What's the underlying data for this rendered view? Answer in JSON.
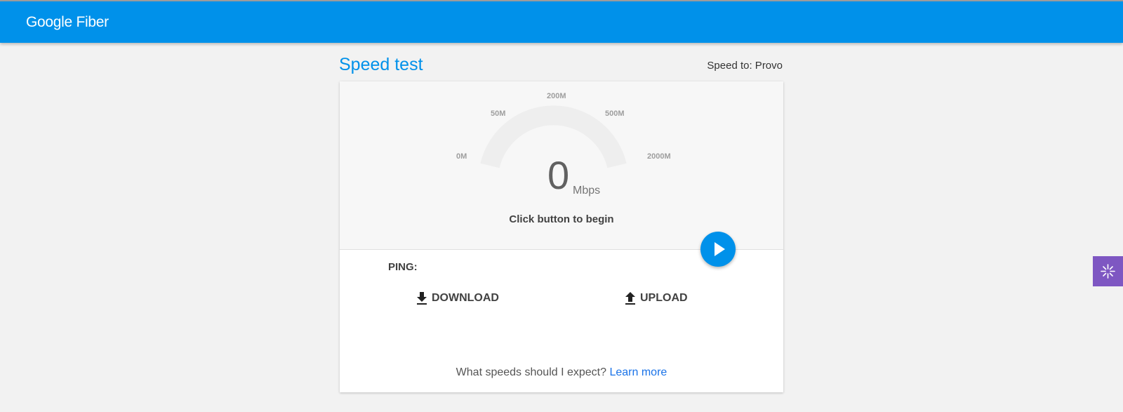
{
  "header": {
    "logo_text": "Google Fiber"
  },
  "page": {
    "title": "Speed test",
    "speed_to": "Speed to: Provo"
  },
  "gauge": {
    "ticks": [
      "0M",
      "50M",
      "200M",
      "500M",
      "2000M"
    ],
    "value": "0",
    "unit": "Mbps",
    "status": "Click button to begin"
  },
  "results": {
    "ping_label": "PING:",
    "download_label": "DOWNLOAD",
    "upload_label": "UPLOAD"
  },
  "footer": {
    "question": "What speeds should I expect?",
    "link": "Learn more"
  },
  "colors": {
    "brand": "#0091ea",
    "widget": "#7e57c2"
  },
  "icons": {
    "play": "play-icon",
    "download": "download-icon",
    "upload": "upload-icon",
    "widget": "sparkle-icon"
  }
}
